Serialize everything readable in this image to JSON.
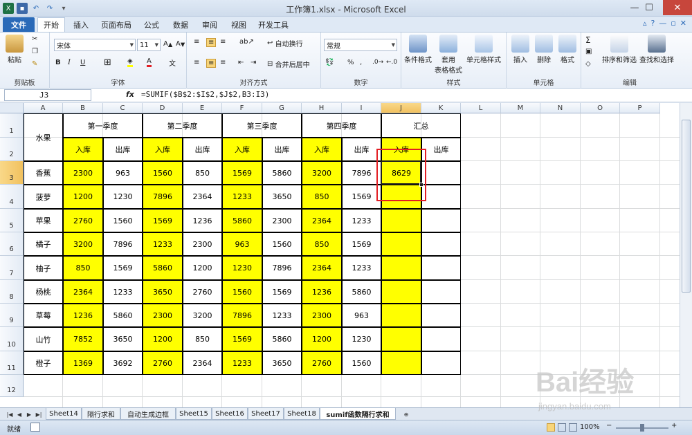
{
  "window": {
    "title": "工作簿1.xlsx  -  Microsoft Excel",
    "minimize": "—",
    "restore": "☐",
    "close": "✕"
  },
  "ribbon_tabs": [
    "文件",
    "开始",
    "插入",
    "页面布局",
    "公式",
    "数据",
    "审阅",
    "视图",
    "开发工具"
  ],
  "ribbon": {
    "clipboard": {
      "label": "剪贴板",
      "paste": "粘贴"
    },
    "font": {
      "label": "字体",
      "name": "宋体",
      "size": "11",
      "bold": "B",
      "italic": "I",
      "underline": "U"
    },
    "alignment": {
      "label": "对齐方式",
      "wrap": "自动换行",
      "merge": "合并后居中"
    },
    "number": {
      "label": "数字",
      "format": "常规",
      "percent": "%",
      "comma": ","
    },
    "styles": {
      "label": "样式",
      "conditional": "条件格式",
      "table": "套用\n表格格式",
      "cell_styles": "单元格样式"
    },
    "cells": {
      "label": "单元格",
      "insert": "插入",
      "delete": "删除",
      "format": "格式"
    },
    "editing": {
      "label": "编辑",
      "sort": "排序和筛选",
      "find": "查找和选择",
      "sigma": "Σ"
    }
  },
  "formula_bar": {
    "name_box": "J3",
    "fx": "fx",
    "formula": "=SUMIF($B$2:$I$2,$J$2,B3:I3)"
  },
  "columns": [
    "A",
    "B",
    "C",
    "D",
    "E",
    "F",
    "G",
    "H",
    "I",
    "J",
    "K",
    "L",
    "M",
    "N",
    "O",
    "P"
  ],
  "rows": [
    "1",
    "2",
    "3",
    "4",
    "5",
    "6",
    "7",
    "8",
    "9",
    "10",
    "11",
    "12"
  ],
  "sheet": {
    "fruit_header": "水果",
    "quarters": [
      "第一季度",
      "第二季度",
      "第三季度",
      "第四季度"
    ],
    "total_header": "汇总",
    "in_label": "入库",
    "out_label": "出库",
    "fruits": [
      "香蕉",
      "菠萝",
      "苹果",
      "橘子",
      "柚子",
      "杨桃",
      "草莓",
      "山竹",
      "橙子"
    ],
    "values": [
      [
        "2300",
        "963",
        "1560",
        "850",
        "1569",
        "5860",
        "3200",
        "7896"
      ],
      [
        "1200",
        "1230",
        "7896",
        "2364",
        "1233",
        "3650",
        "850",
        "1569"
      ],
      [
        "2760",
        "1560",
        "1569",
        "1236",
        "5860",
        "2300",
        "2364",
        "1233"
      ],
      [
        "3200",
        "7896",
        "1233",
        "2300",
        "963",
        "1560",
        "850",
        "1569"
      ],
      [
        "850",
        "1569",
        "5860",
        "1200",
        "1230",
        "7896",
        "2364",
        "1233"
      ],
      [
        "2364",
        "1233",
        "3650",
        "2760",
        "1560",
        "1569",
        "1236",
        "5860"
      ],
      [
        "1236",
        "5860",
        "2300",
        "3200",
        "7896",
        "1233",
        "2300",
        "963"
      ],
      [
        "7852",
        "3650",
        "1200",
        "850",
        "1569",
        "5860",
        "1200",
        "1230"
      ],
      [
        "1369",
        "3692",
        "2760",
        "2364",
        "1233",
        "3650",
        "2760",
        "1560"
      ]
    ],
    "j3_value": "8629"
  },
  "sheet_tabs": [
    "Sheet14",
    "隔行求和",
    "自动生成边框",
    "Sheet15",
    "Sheet16",
    "Sheet17",
    "Sheet18",
    "sumif函数隔行求和"
  ],
  "active_sheet": "sumif函数隔行求和",
  "status": {
    "ready": "就绪",
    "zoom": "100%",
    "zoom_minus": "−",
    "zoom_plus": "+"
  },
  "watermark": {
    "brand": "Bai经验",
    "url": "jingyan.baidu.com"
  },
  "colors": {
    "highlight": "#ffff00",
    "annotation": "#e31e24",
    "file_tab": "#2a6ab8"
  }
}
